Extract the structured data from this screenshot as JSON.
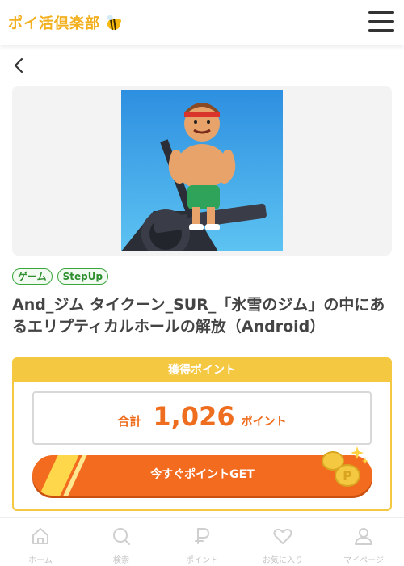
{
  "header": {
    "logo_text": "ポイ活倶楽部",
    "menu_icon": "hamburger-menu-icon"
  },
  "nav": {
    "back_icon": "chevron-left-icon"
  },
  "app": {
    "icon": "app-icon-gym-tycoon"
  },
  "tags": [
    "ゲーム",
    "StepUp"
  ],
  "title": "And_ジム タイクーン_SUR_「氷雪のジム」の中にあるエリプティカルホールの解放（Android）",
  "points": {
    "header": "獲得ポイント",
    "total_label": "合計",
    "total_value": "1,026",
    "unit": "ポイント",
    "button_label": "今すぐポイントGET"
  },
  "bottom_nav": [
    {
      "label": "ホーム",
      "icon": "home-icon"
    },
    {
      "label": "検索",
      "icon": "search-icon"
    },
    {
      "label": "ポイント",
      "icon": "point-icon"
    },
    {
      "label": "お気に入り",
      "icon": "heart-icon"
    },
    {
      "label": "マイページ",
      "icon": "user-icon"
    }
  ],
  "colors": {
    "accent": "#f26b1f",
    "yellow": "#f5c842",
    "tag_green": "#3aa63a",
    "logo": "#f2b01e"
  }
}
